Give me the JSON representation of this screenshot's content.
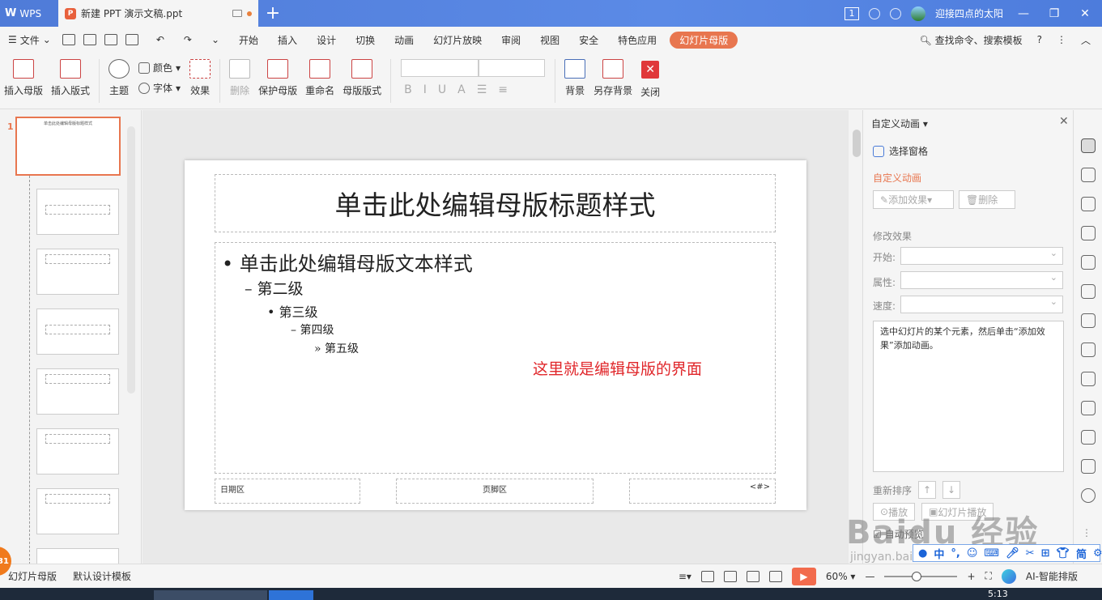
{
  "titlebar": {
    "app_name": "WPS",
    "doc_tab_title": "新建 PPT 演示文稿.ppt",
    "badge_num": "1",
    "user_name": "迎接四点的太阳"
  },
  "menubar": {
    "file": "文件",
    "items": [
      "开始",
      "插入",
      "设计",
      "切换",
      "动画",
      "幻灯片放映",
      "审阅",
      "视图",
      "安全",
      "特色应用"
    ],
    "active_tab": "幻灯片母版",
    "search": "查找命令、搜索模板"
  },
  "ribbon": {
    "insert_master": "插入母版",
    "insert_layout": "插入版式",
    "theme": "主题",
    "color": "颜色",
    "font": "字体",
    "effect": "效果",
    "delete": "删除",
    "protect_master": "保护母版",
    "rename": "重命名",
    "master_layout": "母版版式",
    "background": "背景",
    "save_background": "另存背景",
    "close": "关闭"
  },
  "thumbnails": {
    "master_num": "1",
    "master_title": "单击此处编辑母版标题样式"
  },
  "slide": {
    "title": "单击此处编辑母版标题样式",
    "level1": "• 单击此处编辑母版文本样式",
    "level2": "– 第二级",
    "level3": "• 第三级",
    "level4": "– 第四级",
    "level5": "» 第五级",
    "annotation": "这里就是编辑母版的界面",
    "footer_date": "日期区",
    "footer_text": "页脚区",
    "footer_num": "<#>"
  },
  "panel": {
    "header": "自定义动画",
    "select_pane": "选择窗格",
    "section_custom": "自定义动画",
    "add_effect": "添加效果",
    "delete": "删除",
    "modify_effect": "修改效果",
    "start_label": "开始:",
    "property_label": "属性:",
    "speed_label": "速度:",
    "info_text": "选中幻灯片的某个元素，然后单击“添加效果”添加动画。",
    "reorder_label": "重新排序",
    "play": "播放",
    "slideshow": "幻灯片播放",
    "auto_preview": "自动预览"
  },
  "statusbar": {
    "master_label": "幻灯片母版",
    "template": "默认设计模板",
    "zoom": "60%",
    "ai_layout": "AI-智能排版",
    "badge": "31"
  },
  "taskbar": {
    "time": "5:13"
  },
  "ime": {
    "mode": "中",
    "simplified": "简"
  },
  "watermark": {
    "text": "Baidu 经验",
    "sub": "jingyan.baidu.com"
  },
  "colors": {
    "accent": "#e8764f",
    "titlebar": "#4f7bd8",
    "annotation": "#e0262a"
  }
}
